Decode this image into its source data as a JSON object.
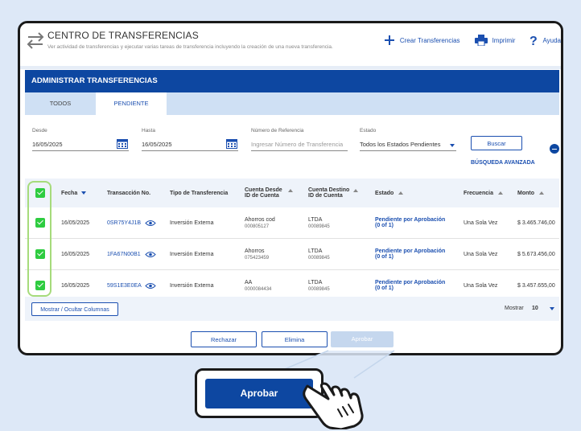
{
  "header": {
    "title": "CENTRO DE TRANSFERENCIAS",
    "subtitle": "Ver actividad de transferencias y ejecutar varias tareas de transferencia incluyendo la creación de una nueva transferencia.",
    "actions": [
      {
        "icon": "plus-icon",
        "label": "Crear Transferencias"
      },
      {
        "icon": "printer-icon",
        "label": "Imprimir"
      },
      {
        "icon": "help-icon",
        "label": "Ayuda"
      }
    ]
  },
  "section": {
    "title": "ADMINISTRAR TRANSFERENCIAS"
  },
  "tabs": [
    {
      "label": "TODOS",
      "active": false
    },
    {
      "label": "PENDIENTE",
      "active": true
    }
  ],
  "filters": {
    "desde_label": "Desde",
    "desde_value": "16/05/2025",
    "hasta_label": "Hasta",
    "hasta_value": "16/05/2025",
    "ref_label": "Número de Referencia",
    "ref_placeholder": "Ingresar Número de Transferencia",
    "estado_label": "Estado",
    "estado_value": "Todos los Estados Pendientes",
    "search_button": "Buscar",
    "advanced_link": "BÚSQUEDA AVANZADA"
  },
  "table": {
    "columns": {
      "fecha": "Fecha",
      "transaccion": "Transacción No.",
      "tipo": "Tipo de Transferencia",
      "cuenta_desde": "Cuenta Desde",
      "cuenta_desde_sub": "ID de Cuenta",
      "cuenta_destino": "Cuenta Destino",
      "cuenta_destino_sub": "ID de Cuenta",
      "estado": "Estado",
      "frecuencia": "Frecuencia",
      "monto": "Monto"
    },
    "rows": [
      {
        "fecha": "16/05/2025",
        "transaccion": "0SR75Y4J1B",
        "tipo": "Inversión Externa",
        "desde": "Ahorros cod",
        "desde_id": "000805127",
        "destino": "LTDA",
        "destino_id": "00089845",
        "estado": "Pendiente por Aprobación",
        "estado_sub": "(0 of 1)",
        "frecuencia": "Una Sola Vez",
        "monto": "$ 3.465.746,00"
      },
      {
        "fecha": "16/05/2025",
        "transaccion": "1FA67N00B1",
        "tipo": "Inversión Externa",
        "desde": "Ahorros",
        "desde_id": "075423459",
        "destino": "LTDA",
        "destino_id": "00089845",
        "estado": "Pendiente por Aprobación",
        "estado_sub": "(0 of 1)",
        "frecuencia": "Una Sola Vez",
        "monto": "$ 5.673.456,00"
      },
      {
        "fecha": "16/05/2025",
        "transaccion": "59S1E3E0EA",
        "tipo": "Inversión Externa",
        "desde": "AA",
        "desde_id": "0000084434",
        "destino": "LTDA",
        "destino_id": "00089845",
        "estado": "Pendiente por Aprobación",
        "estado_sub": "(0 of 1)",
        "frecuencia": "Una Sola Vez",
        "monto": "$ 3.457.655,00"
      }
    ]
  },
  "footer": {
    "columns_button": "Mostrar / Ocultar Columnas",
    "show_label": "Mostrar",
    "show_value": "10"
  },
  "actions": {
    "reject": "Rechazar",
    "delete": "Elimina",
    "approve": "Aprobar"
  },
  "zoom": {
    "approve_label": "Aprobar"
  }
}
